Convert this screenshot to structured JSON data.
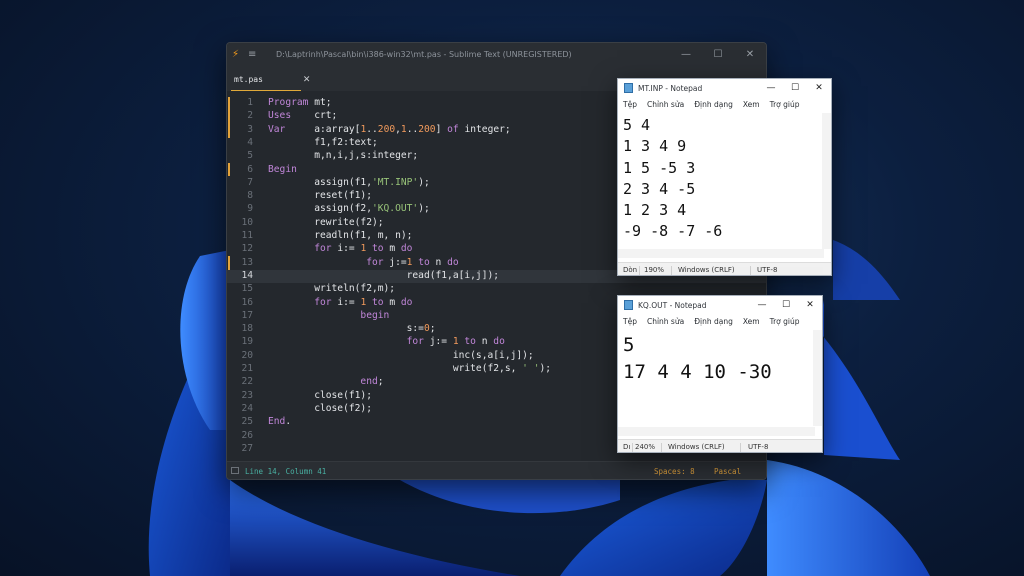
{
  "sublime": {
    "title": "D:\\Laptrinh\\Pascal\\bin\\i386-win32\\mt.pas - Sublime Text (UNREGISTERED)",
    "tab_label": "mt.pas",
    "close_glyph": "✕",
    "status_position": "Line 14, Column 41",
    "status_spaces": "Spaces: 8",
    "status_syntax": "Pascal",
    "active_line": 14,
    "lines": [
      [
        {
          "c": "kw",
          "t": "Program "
        },
        {
          "c": "tx",
          "t": "mt;"
        }
      ],
      [
        {
          "c": "kw",
          "t": "Uses    "
        },
        {
          "c": "tx",
          "t": "crt;"
        }
      ],
      [
        {
          "c": "kw",
          "t": "Var     "
        },
        {
          "c": "tx",
          "t": "a:"
        },
        {
          "c": "fn",
          "t": "array"
        },
        {
          "c": "tx",
          "t": "["
        },
        {
          "c": "num",
          "t": "1"
        },
        {
          "c": "tx",
          "t": ".."
        },
        {
          "c": "num",
          "t": "200"
        },
        {
          "c": "tx",
          "t": ","
        },
        {
          "c": "num",
          "t": "1"
        },
        {
          "c": "tx",
          "t": ".."
        },
        {
          "c": "num",
          "t": "200"
        },
        {
          "c": "tx",
          "t": "] "
        },
        {
          "c": "kw",
          "t": "of"
        },
        {
          "c": "tx",
          "t": " integer;"
        }
      ],
      [
        {
          "c": "tx",
          "t": "        f1,f2:text;"
        }
      ],
      [
        {
          "c": "tx",
          "t": "        m,n,i,j,s:integer;"
        }
      ],
      [
        {
          "c": "kw",
          "t": "Begin"
        }
      ],
      [
        {
          "c": "tx",
          "t": "        assign(f1,"
        },
        {
          "c": "str",
          "t": "'MT.INP'"
        },
        {
          "c": "tx",
          "t": ");"
        }
      ],
      [
        {
          "c": "tx",
          "t": "        reset(f1);"
        }
      ],
      [
        {
          "c": "tx",
          "t": "        assign(f2,"
        },
        {
          "c": "str",
          "t": "'KQ.OUT'"
        },
        {
          "c": "tx",
          "t": ");"
        }
      ],
      [
        {
          "c": "tx",
          "t": "        rewrite(f2);"
        }
      ],
      [
        {
          "c": "tx",
          "t": "        readln(f1, m, n);"
        }
      ],
      [
        {
          "c": "tx",
          "t": "        "
        },
        {
          "c": "kw",
          "t": "for"
        },
        {
          "c": "tx",
          "t": " i:= "
        },
        {
          "c": "num",
          "t": "1"
        },
        {
          "c": "tx",
          "t": " "
        },
        {
          "c": "kw",
          "t": "to"
        },
        {
          "c": "tx",
          "t": " m "
        },
        {
          "c": "kw",
          "t": "do"
        }
      ],
      [
        {
          "c": "tx",
          "t": "                 "
        },
        {
          "c": "kw",
          "t": "for"
        },
        {
          "c": "tx",
          "t": " j:="
        },
        {
          "c": "num",
          "t": "1"
        },
        {
          "c": "tx",
          "t": " "
        },
        {
          "c": "kw",
          "t": "to"
        },
        {
          "c": "tx",
          "t": " n "
        },
        {
          "c": "kw",
          "t": "do"
        }
      ],
      [
        {
          "c": "tx",
          "t": "                        read(f1,a[i,j]);"
        }
      ],
      [
        {
          "c": "tx",
          "t": "        writeln(f2,m);"
        }
      ],
      [
        {
          "c": "tx",
          "t": "        "
        },
        {
          "c": "kw",
          "t": "for"
        },
        {
          "c": "tx",
          "t": " i:= "
        },
        {
          "c": "num",
          "t": "1"
        },
        {
          "c": "tx",
          "t": " "
        },
        {
          "c": "kw",
          "t": "to"
        },
        {
          "c": "tx",
          "t": " m "
        },
        {
          "c": "kw",
          "t": "do"
        }
      ],
      [
        {
          "c": "tx",
          "t": "                "
        },
        {
          "c": "kw",
          "t": "begin"
        }
      ],
      [
        {
          "c": "tx",
          "t": "                        s:="
        },
        {
          "c": "num",
          "t": "0"
        },
        {
          "c": "tx",
          "t": ";"
        }
      ],
      [
        {
          "c": "tx",
          "t": "                        "
        },
        {
          "c": "kw",
          "t": "for"
        },
        {
          "c": "tx",
          "t": " j:= "
        },
        {
          "c": "num",
          "t": "1"
        },
        {
          "c": "tx",
          "t": " "
        },
        {
          "c": "kw",
          "t": "to"
        },
        {
          "c": "tx",
          "t": " n "
        },
        {
          "c": "kw",
          "t": "do"
        }
      ],
      [
        {
          "c": "tx",
          "t": "                                inc(s,a[i,j]);"
        }
      ],
      [
        {
          "c": "tx",
          "t": "                                write(f2,s, "
        },
        {
          "c": "str",
          "t": "' '"
        },
        {
          "c": "tx",
          "t": ");"
        }
      ],
      [
        {
          "c": "tx",
          "t": "                "
        },
        {
          "c": "kw",
          "t": "end"
        },
        {
          "c": "tx",
          "t": ";"
        }
      ],
      [
        {
          "c": "tx",
          "t": "        close(f1);"
        }
      ],
      [
        {
          "c": "tx",
          "t": "        close(f2);"
        }
      ],
      [
        {
          "c": "kw",
          "t": "End"
        },
        {
          "c": "tx",
          "t": "."
        }
      ],
      [],
      []
    ]
  },
  "notepad_inp": {
    "title": "MT.INP - Notepad",
    "menu": [
      "Tệp",
      "Chỉnh sửa",
      "Định dạng",
      "Xem",
      "Trợ giúp"
    ],
    "content": "5 4\n1 3 4 9\n1 5 -5 3\n2 3 4 -5\n1 2 3 4\n-9 -8 -7 -6",
    "status_ln": "Dòn",
    "status_zoom": "190%",
    "status_eol": "Windows (CRLF)",
    "status_enc": "UTF-8"
  },
  "notepad_out": {
    "title": "KQ.OUT - Notepad",
    "menu": [
      "Tệp",
      "Chỉnh sửa",
      "Định dạng",
      "Xem",
      "Trợ giúp"
    ],
    "content": "5\n17 4 4 10 -30",
    "status_ln": "Dı",
    "status_zoom": "240%",
    "status_eol": "Windows (CRLF)",
    "status_enc": "UTF-8"
  },
  "window_controls": {
    "minimize": "—",
    "maximize": "☐",
    "close": "✕"
  },
  "colors": {
    "keyword": "#c086d8",
    "number": "#f19a5c",
    "string": "#98c379",
    "accent": "#e3a33b"
  }
}
